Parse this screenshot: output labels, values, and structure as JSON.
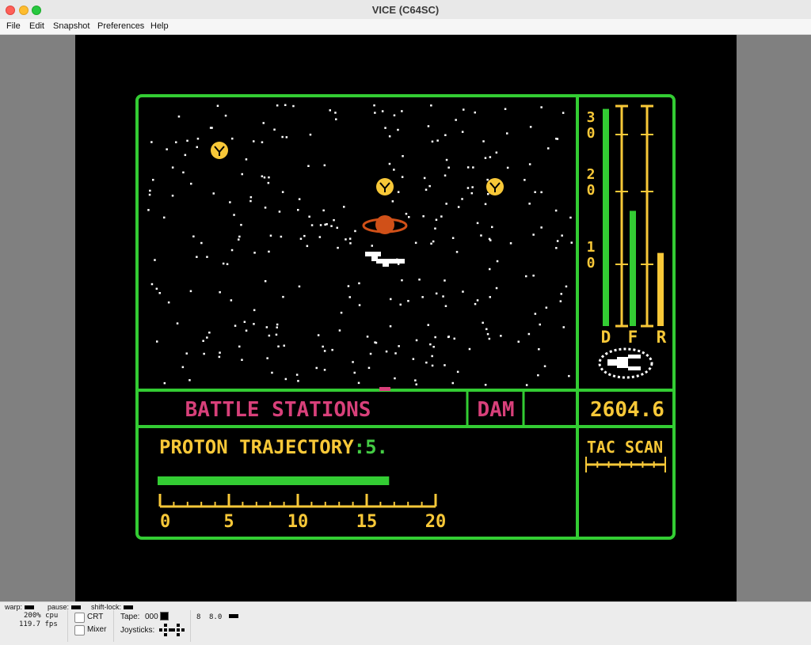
{
  "window": {
    "title": "VICE (C64SC)"
  },
  "menu": {
    "file": "File",
    "edit": "Edit",
    "snapshot": "Snapshot",
    "preferences": "Preferences",
    "help": "Help"
  },
  "game": {
    "status_message": "BATTLE STATIONS",
    "damage_label": "DAM",
    "stardate": "2604.6",
    "trajectory_label": "PROTON TRAJECTORY",
    "trajectory_sep": ":",
    "trajectory_value": "5.",
    "trajectory_fraction": 0.84,
    "scale_labels": [
      "0",
      "5",
      "10",
      "15",
      "20"
    ],
    "tac_scan_label": "TAC SCAN",
    "gauge_ticks": [
      "30",
      "20",
      "10"
    ],
    "gauge_letters": [
      "D",
      "F",
      "R"
    ],
    "gauge_levels": {
      "D": 0.98,
      "F": 0.52,
      "R": 0.33
    },
    "colors": {
      "frame": "#33cc33",
      "yellow": "#f8c838",
      "magenta": "#d8407a",
      "green_text": "#44cc44",
      "planet": "#d05018"
    }
  },
  "status": {
    "warp_label": "warp:",
    "pause_label": "pause:",
    "shiftlock_label": "shift-lock:",
    "cpu": "200% cpu",
    "fps": "119.7 fps",
    "crt_label": "CRT",
    "mixer_label": "Mixer",
    "tape_label": "Tape:",
    "tape_counter": "000",
    "joysticks_label": "Joysticks:",
    "drive_num": "8",
    "drive_track": "8.0"
  }
}
